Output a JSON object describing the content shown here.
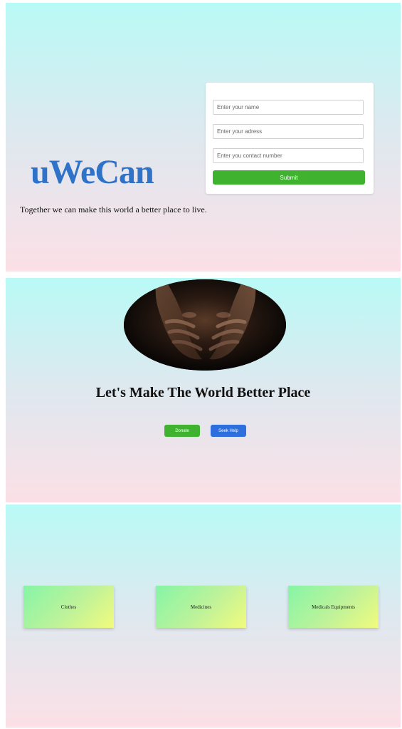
{
  "section1": {
    "brand": "uWeCan",
    "tagline": "Together we can make this world a better place to live.",
    "form": {
      "name_placeholder": "Enter your name",
      "address_placeholder": "Enter your adress",
      "contact_placeholder": "Enter you contact number",
      "submit_label": "Submit"
    }
  },
  "section2": {
    "hero_image": "cupped-hands-photo",
    "headline": "Let's Make The World Better Place",
    "donate_label": "Donate",
    "seek_help_label": "Seek Help"
  },
  "section3": {
    "categories": [
      "Clothes",
      "Medicines",
      "Medicals Equipments"
    ]
  },
  "colors": {
    "brand_blue": "#2f73c9",
    "green": "#3fb32f",
    "blue_button": "#2e6fde",
    "gradient_top": "#b9faf6",
    "gradient_bottom": "#fbe0e6"
  }
}
